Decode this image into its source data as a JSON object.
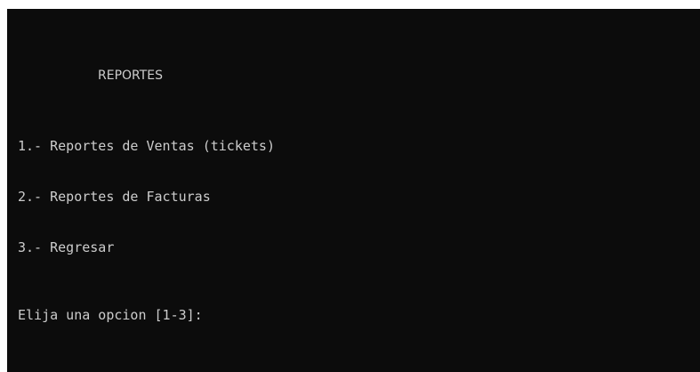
{
  "console": {
    "title": "REPORTES",
    "options": [
      "1.- Reportes de Ventas (tickets)",
      "2.- Reportes de Facturas",
      "3.- Regresar"
    ],
    "prompt": "Elija una opcion [1-3]:",
    "colors": {
      "background": "#0c0c0c",
      "text": "#cccccc"
    }
  }
}
